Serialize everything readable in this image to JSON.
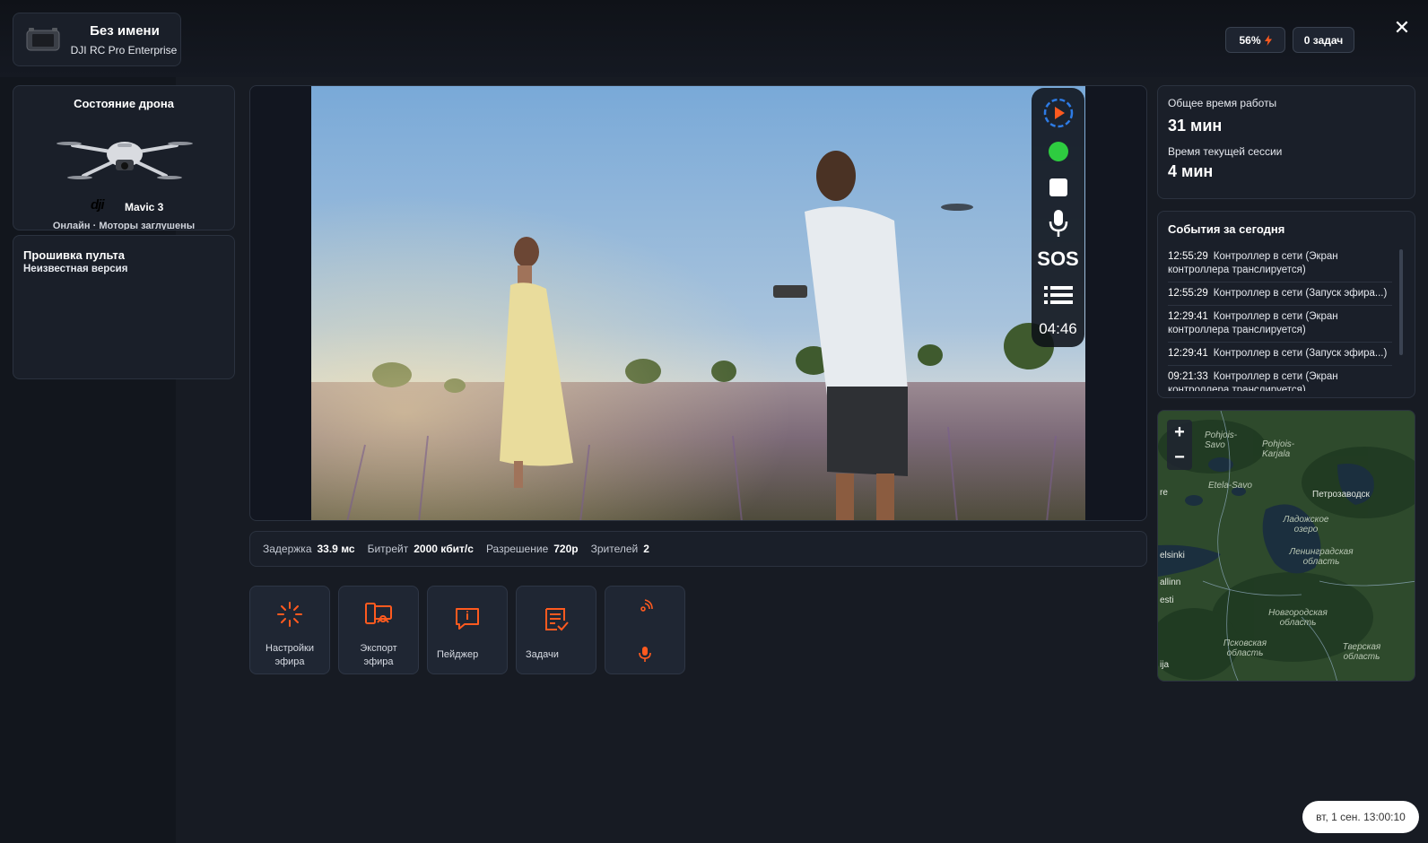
{
  "header": {
    "device_name": "Без имени",
    "device_model": "DJI RC Pro Enterprise",
    "battery": "56%",
    "tasks": "0 задач"
  },
  "drone": {
    "title": "Состояние дрона",
    "brand_logo": "dji",
    "model": "Mavic 3",
    "status": "Онлайн · Моторы заглушены"
  },
  "firmware": {
    "title": "Прошивка пульта",
    "value": "Неизвестная версия"
  },
  "toolbar": {
    "sos": "SOS",
    "timer": "04:46",
    "live_color": "#2ecc40",
    "play_color": "#ff5a1f"
  },
  "stats": {
    "latency_label": "Задержка",
    "latency_value": "33.9 мс",
    "bitrate_label": "Битрейт",
    "bitrate_value": "2000 кбит/с",
    "resolution_label": "Разрешение",
    "resolution_value": "720p",
    "viewers_label": "Зрителей",
    "viewers_value": "2"
  },
  "actions": [
    {
      "label": "Настройки эфира",
      "icon": "broadcast-settings-icon"
    },
    {
      "label": "Экспорт эфира",
      "icon": "broadcast-export-icon"
    },
    {
      "label": "Пейджер",
      "icon": "pager-icon"
    },
    {
      "label": "Задачи",
      "icon": "tasks-icon"
    },
    {
      "label": "",
      "icon": "radio-mic-icon"
    }
  ],
  "time": {
    "total_label": "Общее время работы",
    "total_value": "31 мин",
    "session_label": "Время текущей сессии",
    "session_value": "4 мин"
  },
  "events": {
    "title": "События за сегодня",
    "items": [
      {
        "time": "12:55:29",
        "text": "Контроллер в сети (Экран контроллера транслируется)"
      },
      {
        "time": "12:55:29",
        "text": "Контроллер в сети (Запуск эфира...)"
      },
      {
        "time": "12:29:41",
        "text": "Контроллер в сети (Экран контроллера транслируется)"
      },
      {
        "time": "12:29:41",
        "text": "Контроллер в сети (Запуск эфира...)"
      },
      {
        "time": "09:21:33",
        "text": "Контроллер в сети (Экран контроллера транслируется)"
      }
    ]
  },
  "map": {
    "zoom_in": "+",
    "zoom_out": "−",
    "labels": [
      "Pohjois-Savo",
      "Pohjois-Karjala",
      "Etela-Savo",
      "Петрозаводск",
      "Ладожское озеро",
      "Ленинградская область",
      "Новгородская область",
      "Псковская область",
      "Тверская область",
      "elsinki",
      "allinn",
      "esti",
      "ija",
      "re"
    ]
  },
  "clock": "вт, 1 сен. 13:00:10",
  "colors": {
    "accent": "#ff5a1f",
    "background": "#171b23",
    "panel": "#1a1f29"
  }
}
